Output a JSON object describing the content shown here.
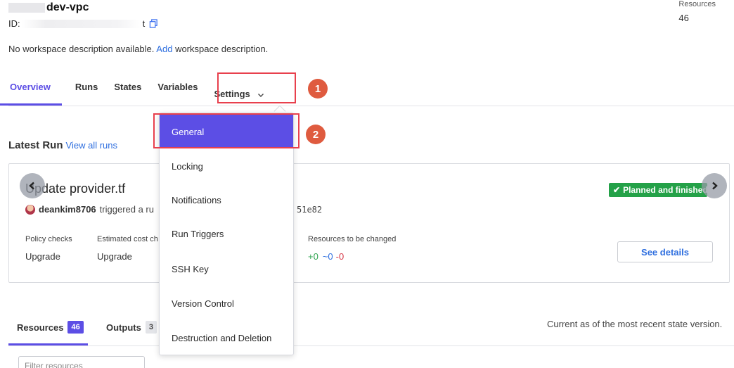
{
  "workspace": {
    "title": "dev-vpc",
    "id_label": "ID:",
    "id_suffix": "t",
    "description_prefix": "No workspace description available.",
    "description_link": "Add",
    "description_suffix": "workspace description."
  },
  "resources_summary": {
    "label": "Resources",
    "count": "46"
  },
  "tabs": [
    {
      "label": "Overview",
      "active": true
    },
    {
      "label": "Runs"
    },
    {
      "label": "States"
    },
    {
      "label": "Variables"
    },
    {
      "label": "Settings",
      "icon": "chevron-down-icon"
    }
  ],
  "annotations": [
    {
      "label": "1"
    },
    {
      "label": "2"
    }
  ],
  "latest_run": {
    "heading": "Latest Run",
    "view_all": "View all runs",
    "title": "Update provider.tf",
    "user": "deankim8706",
    "triggered": "triggered a ru",
    "hash": "51e82",
    "status": "Planned and finished",
    "status_color": "#24a148",
    "policy_checks_label": "Policy checks",
    "policy_checks_value": "Upgrade",
    "estimated_cost_label": "Estimated cost ch",
    "estimated_cost_value": "Upgrade",
    "resources_changed_label": "Resources to be changed",
    "add": "+0",
    "change": "~0",
    "destroy": "-0",
    "see_details": "See details"
  },
  "settings_menu": {
    "items": [
      {
        "label": "General",
        "active": true
      },
      {
        "label": "Locking"
      },
      {
        "label": "Notifications"
      },
      {
        "label": "Run Triggers"
      },
      {
        "label": "SSH Key"
      },
      {
        "label": "Version Control"
      },
      {
        "label": "Destruction and Deletion"
      }
    ]
  },
  "bottom_tabs": {
    "resources_label": "Resources",
    "resources_count": "46",
    "outputs_label": "Outputs",
    "outputs_count": "3",
    "current_as_of": "Current as of the most recent state version."
  },
  "filter": {
    "placeholder": "Filter resources"
  },
  "colors": {
    "accent": "#5c4ee5",
    "link": "#2f6fdf",
    "highlight": "#e8404d",
    "badge": "#df5b3f"
  }
}
